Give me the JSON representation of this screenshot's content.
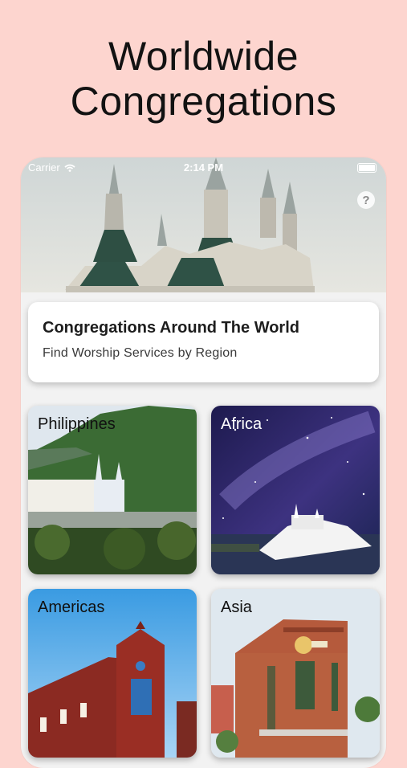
{
  "headline": {
    "line1": "Worldwide",
    "line2": "Congregations"
  },
  "status_bar": {
    "carrier": "Carrier",
    "time": "2:14 PM"
  },
  "hero": {
    "help_icon": "question-icon",
    "help_label": "?"
  },
  "info_card": {
    "title": "Congregations Around The World",
    "subtitle": "Find Worship Services by Region"
  },
  "regions": [
    {
      "label": "Philippines"
    },
    {
      "label": "Africa"
    },
    {
      "label": "Americas"
    },
    {
      "label": "Asia"
    }
  ]
}
